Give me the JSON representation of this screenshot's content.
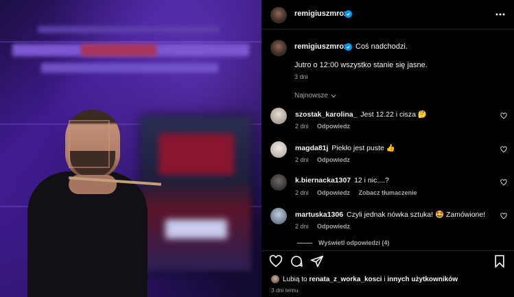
{
  "post": {
    "author": "remigiuszmroz",
    "caption_text": "Coś nadchodzi.",
    "caption_line2": "Jutro o 12:00 wszystko stanie się jasne.",
    "caption_time": "3 dni"
  },
  "sort": {
    "label": "Najnowsze"
  },
  "comments": [
    {
      "user": "szostak_karolina_",
      "text": "Jest 12.22 i cisza 🤔",
      "time": "2 dni",
      "reply": "Odpowiedz",
      "extra": "",
      "avatar_color": "#c8c2b6"
    },
    {
      "user": "magda81j",
      "text": "Piekło jest puste 👍",
      "time": "2 dni",
      "reply": "Odpowiedz",
      "extra": "",
      "avatar_color": "#d9d3cc"
    },
    {
      "user": "k.biernacka1307",
      "text": "12 i nic....?",
      "time": "2 dni",
      "reply": "Odpowiedz",
      "extra": "Zobacz tłumaczenie",
      "avatar_color": "#3b3836"
    },
    {
      "user": "martuska1306",
      "text": "Czyli jednak nówka sztuka! 🤩 Zamówione!",
      "time": "2 dni",
      "reply": "Odpowiedz",
      "extra": "",
      "avatar_color": "#8aa0b8"
    }
  ],
  "view_replies": "Wyświetl odpowiedzi (4)",
  "likes": {
    "prefix": "Lubią to ",
    "user": "renata_z_worka_kosci",
    "middle": " i ",
    "others": "innych użytkowników"
  },
  "post_time": "3 dni temu",
  "colors": {
    "verified": "#0095f6",
    "secondary_text": "#a8a8a8",
    "divider": "#262626"
  },
  "icons": [
    "more-icon",
    "heart-icon",
    "comment-icon",
    "share-icon",
    "bookmark-icon",
    "verified-icon",
    "chevron-down-icon"
  ]
}
